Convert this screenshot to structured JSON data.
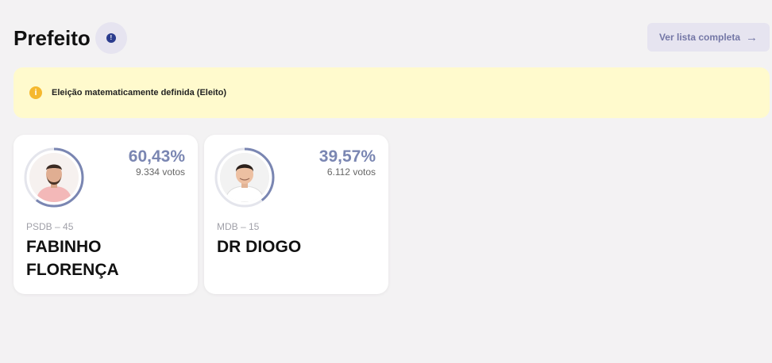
{
  "page": {
    "title": "Prefeito",
    "info_icon": "info-icon",
    "full_list_label": "Ver lista completa",
    "full_list_icon": "arrow-right-icon",
    "accent_color": "#7a86b2"
  },
  "alert": {
    "icon": "info-icon",
    "text": "Eleição matematicamente definida (Eleito)",
    "background": "#fffacd",
    "icon_color": "#f5b82e"
  },
  "candidates": [
    {
      "percent": "60,43%",
      "percent_value": 60.43,
      "votes": "9.334 votos",
      "party": "PSDB – 45",
      "name": "FABINHO FLORENÇA",
      "photo": "candidate-photo"
    },
    {
      "percent": "39,57%",
      "percent_value": 39.57,
      "votes": "6.112 votos",
      "party": "MDB – 15",
      "name": "DR DIOGO",
      "photo": "candidate-photo"
    }
  ]
}
